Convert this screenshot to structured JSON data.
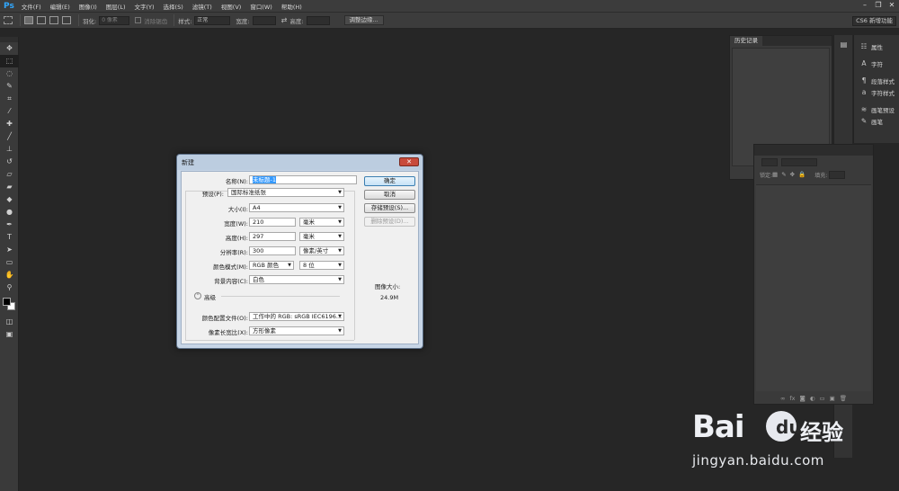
{
  "app": {
    "logo": "Ps"
  },
  "menu": [
    "文件(F)",
    "编辑(E)",
    "图像(I)",
    "图层(L)",
    "文字(Y)",
    "选择(S)",
    "滤镜(T)",
    "视图(V)",
    "窗口(W)",
    "帮助(H)"
  ],
  "window_controls": {
    "minimize": "–",
    "restore": "❐",
    "close": "✕"
  },
  "options_bar": {
    "feather_label": "羽化:",
    "feather_value": "0 像素",
    "antialias_label": "消除锯齿",
    "style_label": "样式:",
    "style_value": "正常",
    "width_label": "宽度:",
    "height_label": "高度:",
    "refine_edge_button": "调整边缘...",
    "workspace_button": "CS6 新增功能"
  },
  "panels": {
    "history_tab": "历史记录",
    "dock": [
      "属性",
      "字符",
      "段落样式",
      "字符样式",
      "画笔预设",
      "画笔"
    ],
    "layers_lock_label": "锁定:",
    "layers_fill_label": "填充:"
  },
  "dialog": {
    "title": "新建",
    "name_label": "名称(N):",
    "name_value": "未标题-1",
    "preset_label": "预设(P):",
    "preset_value": "国际标准纸张",
    "size_label": "大小(I):",
    "size_value": "A4",
    "width_label": "宽度(W):",
    "width_value": "210",
    "width_unit": "毫米",
    "height_label": "高度(H):",
    "height_value": "297",
    "height_unit": "毫米",
    "resolution_label": "分辨率(R):",
    "resolution_value": "300",
    "resolution_unit": "像素/英寸",
    "color_mode_label": "颜色模式(M):",
    "color_mode_value": "RGB 颜色",
    "bit_depth_value": "8 位",
    "background_label": "背景内容(C):",
    "background_value": "白色",
    "advanced_label": "高级",
    "color_profile_label": "颜色配置文件(O):",
    "color_profile_value": "工作中的 RGB: sRGB IEC6196...",
    "pixel_aspect_label": "像素长宽比(X):",
    "pixel_aspect_value": "方形像素",
    "ok_button": "确定",
    "cancel_button": "取消",
    "save_preset_button": "存储预设(S)...",
    "delete_preset_button": "删除预设(D)...",
    "image_size_label": "图像大小:",
    "image_size_value": "24.9M",
    "close_glyph": "✕"
  },
  "watermark": {
    "brand_a": "Bai",
    "brand_paw": "du",
    "brand_b": "经验",
    "url": "jingyan.baidu.com"
  },
  "colors": {
    "workspace": "#262626",
    "panel": "#3a3a3a",
    "ps_blue": "#31a8ff",
    "dialog_frame": "#c7d5e6",
    "selection": "#3399ff"
  }
}
